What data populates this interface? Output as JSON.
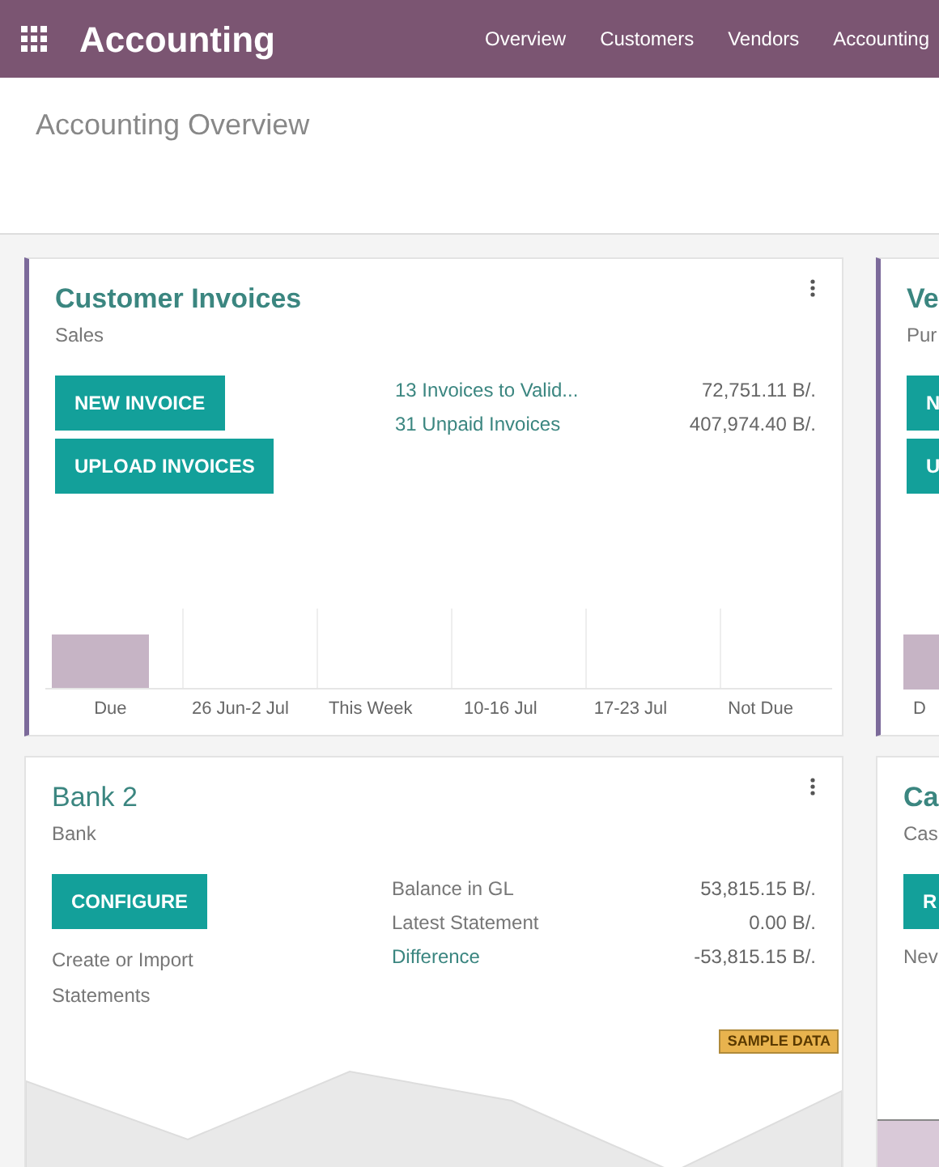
{
  "navbar": {
    "app_name": "Accounting",
    "menu": [
      "Overview",
      "Customers",
      "Vendors",
      "Accounting"
    ]
  },
  "breadcrumb": "Accounting Overview",
  "cards": [
    {
      "kind": "invoices",
      "title": "Customer Invoices",
      "subtitle": "Sales",
      "buttons": [
        "NEW INVOICE",
        "UPLOAD INVOICES"
      ],
      "stats": [
        {
          "label": "13 Invoices to Valid...",
          "value": "72,751.11 B/."
        },
        {
          "label": "31 Unpaid Invoices",
          "value": "407,974.40 B/."
        }
      ],
      "chart_labels": [
        "Due",
        "26 Jun-2 Jul",
        "This Week",
        "10-16 Jul",
        "17-23 Jul",
        "Not Due"
      ]
    },
    {
      "kind": "bank",
      "title": "Bank 2",
      "subtitle": "Bank",
      "buttons": [
        "CONFIGURE"
      ],
      "note": "Create or Import Statements",
      "stats": [
        {
          "label": "Balance in GL",
          "value": "53,815.15 B/.",
          "link": false
        },
        {
          "label": "Latest Statement",
          "value": "0.00 B/.",
          "link": false
        },
        {
          "label": "Difference",
          "value": "-53,815.15 B/.",
          "link": true
        }
      ],
      "badge": "SAMPLE DATA"
    }
  ],
  "side_cards": [
    {
      "kind": "invoices",
      "title": "Ve",
      "subtitle": "Pur",
      "buttons": [
        "N",
        "U"
      ],
      "chart_label": "D"
    },
    {
      "kind": "bank",
      "title": "Ca",
      "subtitle": "Cas",
      "buttons": [
        "R"
      ],
      "note": "Nev"
    }
  ]
}
